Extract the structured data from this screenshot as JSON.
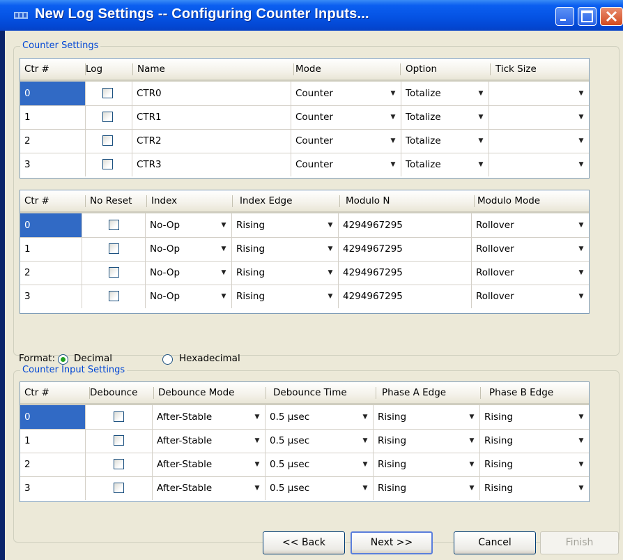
{
  "window": {
    "title": "New Log Settings -- Configuring Counter Inputs..."
  },
  "counter_settings": {
    "label": "Counter Settings",
    "columns": [
      "Ctr #",
      "Log",
      "Name",
      "Mode",
      "Option",
      "Tick Size"
    ],
    "rows": [
      {
        "ctr": "0",
        "log": false,
        "name": "CTR0",
        "mode": "Counter",
        "option": "Totalize",
        "tick_size": ""
      },
      {
        "ctr": "1",
        "log": false,
        "name": "CTR1",
        "mode": "Counter",
        "option": "Totalize",
        "tick_size": ""
      },
      {
        "ctr": "2",
        "log": false,
        "name": "CTR2",
        "mode": "Counter",
        "option": "Totalize",
        "tick_size": ""
      },
      {
        "ctr": "3",
        "log": false,
        "name": "CTR3",
        "mode": "Counter",
        "option": "Totalize",
        "tick_size": ""
      }
    ]
  },
  "counter_index": {
    "columns": [
      "Ctr #",
      "No Reset",
      "Index",
      "Index Edge",
      "Modulo N",
      "Modulo Mode"
    ],
    "rows": [
      {
        "ctr": "0",
        "no_reset": false,
        "index": "No-Op",
        "index_edge": "Rising",
        "modulo_n": "4294967295",
        "modulo_mode": "Rollover"
      },
      {
        "ctr": "1",
        "no_reset": false,
        "index": "No-Op",
        "index_edge": "Rising",
        "modulo_n": "4294967295",
        "modulo_mode": "Rollover"
      },
      {
        "ctr": "2",
        "no_reset": false,
        "index": "No-Op",
        "index_edge": "Rising",
        "modulo_n": "4294967295",
        "modulo_mode": "Rollover"
      },
      {
        "ctr": "3",
        "no_reset": false,
        "index": "No-Op",
        "index_edge": "Rising",
        "modulo_n": "4294967295",
        "modulo_mode": "Rollover"
      }
    ]
  },
  "format": {
    "label": "Format:",
    "options": [
      "Decimal",
      "Hexadecimal"
    ],
    "selected": "Decimal"
  },
  "counter_input_settings": {
    "label": "Counter Input Settings",
    "columns": [
      "Ctr #",
      "Debounce",
      "Debounce Mode",
      "Debounce Time",
      "Phase A Edge",
      "Phase B Edge"
    ],
    "rows": [
      {
        "ctr": "0",
        "debounce": false,
        "debounce_mode": "After-Stable",
        "debounce_time": "0.5 µsec",
        "phase_a": "Rising",
        "phase_b": "Rising"
      },
      {
        "ctr": "1",
        "debounce": false,
        "debounce_mode": "After-Stable",
        "debounce_time": "0.5 µsec",
        "phase_a": "Rising",
        "phase_b": "Rising"
      },
      {
        "ctr": "2",
        "debounce": false,
        "debounce_mode": "After-Stable",
        "debounce_time": "0.5 µsec",
        "phase_a": "Rising",
        "phase_b": "Rising"
      },
      {
        "ctr": "3",
        "debounce": false,
        "debounce_mode": "After-Stable",
        "debounce_time": "0.5 µsec",
        "phase_a": "Rising",
        "phase_b": "Rising"
      }
    ]
  },
  "buttons": {
    "back": "<< Back",
    "next": "Next >>",
    "cancel": "Cancel",
    "finish": "Finish"
  },
  "icons": {
    "dropdown": "dropdown-arrow-icon",
    "minimize": "minimize-icon",
    "maximize": "maximize-icon",
    "close": "close-icon"
  },
  "colors": {
    "titlebar": "#0553e4",
    "selection": "#316ac5",
    "group_label": "#0046d5",
    "dialog_bg": "#ece9d8"
  }
}
